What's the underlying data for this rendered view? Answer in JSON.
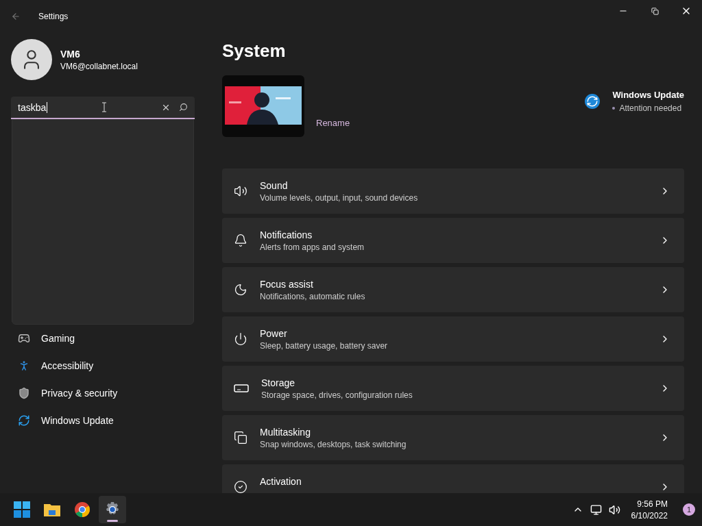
{
  "window": {
    "title": "Settings"
  },
  "account": {
    "name": "VM6",
    "email": "VM6@collabnet.local"
  },
  "search": {
    "value": "taskba"
  },
  "nav": [
    {
      "label": "Gaming",
      "selected": false
    },
    {
      "label": "Accessibility",
      "selected": false
    },
    {
      "label": "Privacy & security",
      "selected": false
    },
    {
      "label": "Windows Update",
      "selected": false
    }
  ],
  "page_title": "System",
  "device": {
    "rename": "Rename",
    "update_title": "Windows Update",
    "update_status": "Attention needed"
  },
  "cards": [
    {
      "title": "Sound",
      "subtitle": "Volume levels, output, input, sound devices"
    },
    {
      "title": "Notifications",
      "subtitle": "Alerts from apps and system"
    },
    {
      "title": "Focus assist",
      "subtitle": "Notifications, automatic rules"
    },
    {
      "title": "Power",
      "subtitle": "Sleep, battery usage, battery saver"
    },
    {
      "title": "Storage",
      "subtitle": "Storage space, drives, configuration rules"
    },
    {
      "title": "Multitasking",
      "subtitle": "Snap windows, desktops, task switching"
    },
    {
      "title": "Activation"
    }
  ],
  "taskbar": {
    "apps": [
      {
        "kind": "start",
        "active": false
      },
      {
        "kind": "explorer",
        "active": false
      },
      {
        "kind": "browser",
        "active": false
      },
      {
        "kind": "settings",
        "active": true
      }
    ],
    "time": "9:56 PM",
    "date": "6/10/2022",
    "badge": "1"
  }
}
